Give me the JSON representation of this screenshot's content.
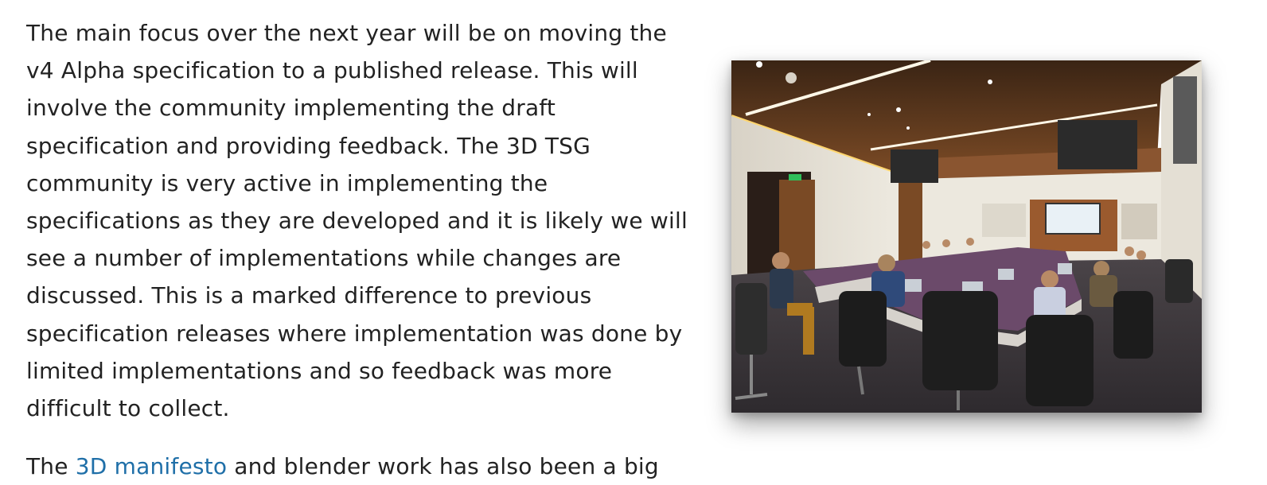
{
  "article": {
    "paragraph1": "The main focus over the next year will be on moving the v4 Alpha specification to a published release. This will involve the community implementing the draft specification and providing feedback. The 3D TSG community is very active in implementing the specifications as they are developed and it is likely we will see a number of implementations while changes are discussed. This is a marked difference to previous specification releases where implementation was done by limited implementations and so feedback was more difficult to collect.",
    "paragraph2_before": "The ",
    "paragraph2_link": "3D manifesto",
    "paragraph2_after": " and blender work has also been a big"
  },
  "colors": {
    "text": "#222222",
    "link": "#1f6fa8"
  }
}
